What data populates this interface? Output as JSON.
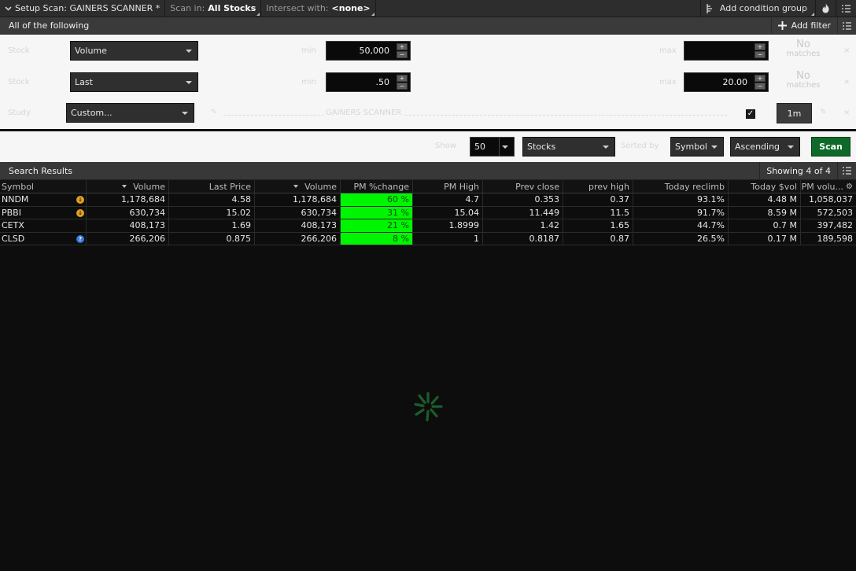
{
  "topbar": {
    "setup_scan_label": "Setup Scan: GAINERS SCANNER *",
    "scan_in_label": "Scan in:",
    "scan_in_value": "All Stocks",
    "intersect_label": "Intersect with:",
    "intersect_value": "<none>",
    "add_condition_group": "Add condition group"
  },
  "filters": {
    "header": "All of the following",
    "add_filter": "Add filter",
    "rows": [
      {
        "type_label": "Stock",
        "field": "Volume",
        "min_label": "min",
        "min": "50,000",
        "max_label": "max",
        "max": "",
        "status_line1": "No",
        "status_line2": "matches"
      },
      {
        "type_label": "Stock",
        "field": "Last",
        "min_label": "min",
        "min": ".50",
        "max_label": "max",
        "max": "20.00",
        "status_line1": "No",
        "status_line2": "matches"
      },
      {
        "type_label": "Study",
        "field": "Custom...",
        "plot_label": "GAINERS SCANNER",
        "aggregation": "1m"
      }
    ]
  },
  "scan_controls": {
    "show_label": "Show",
    "show_value": "50",
    "type_value": "Stocks",
    "sorted_by_label": "Sorted by",
    "sort_field": "Symbol",
    "sort_order": "Ascending",
    "scan_button": "Scan"
  },
  "results": {
    "title": "Search Results",
    "showing": "Showing 4 of 4",
    "columns": [
      "Symbol",
      "Volume",
      "Last Price",
      "Volume",
      "PM %change",
      "PM High",
      "Prev close",
      "prev high",
      "Today reclimb",
      "Today $vol",
      "PM volu..."
    ],
    "rows": [
      {
        "symbol": "NNDM",
        "badge": "earnings",
        "cells": [
          "1,178,684",
          "4.58",
          "1,178,684",
          "60 %",
          "4.7",
          "0.353",
          "0.37",
          "93.1%",
          "4.48 M",
          "1,058,037"
        ]
      },
      {
        "symbol": "PBBI",
        "badge": "earnings",
        "cells": [
          "630,734",
          "15.02",
          "630,734",
          "31 %",
          "15.04",
          "11.449",
          "11.5",
          "91.7%",
          "8.59 M",
          "572,503"
        ]
      },
      {
        "symbol": "CETX",
        "badge": "",
        "cells": [
          "408,173",
          "1.69",
          "408,173",
          "21 %",
          "1.8999",
          "1.42",
          "1.65",
          "44.7%",
          "0.7 M",
          "397,482"
        ]
      },
      {
        "symbol": "CLSD",
        "badge": "info",
        "cells": [
          "266,206",
          "0.875",
          "266,206",
          "8 %",
          "1",
          "0.8187",
          "0.87",
          "26.5%",
          "0.17 M",
          "189,598"
        ]
      }
    ]
  },
  "colors": {
    "pm_change_bg": "#00f500",
    "scan_button": "#0f6a2a",
    "earnings_badge": "#e0a020",
    "info_badge": "#3a7bd5"
  }
}
